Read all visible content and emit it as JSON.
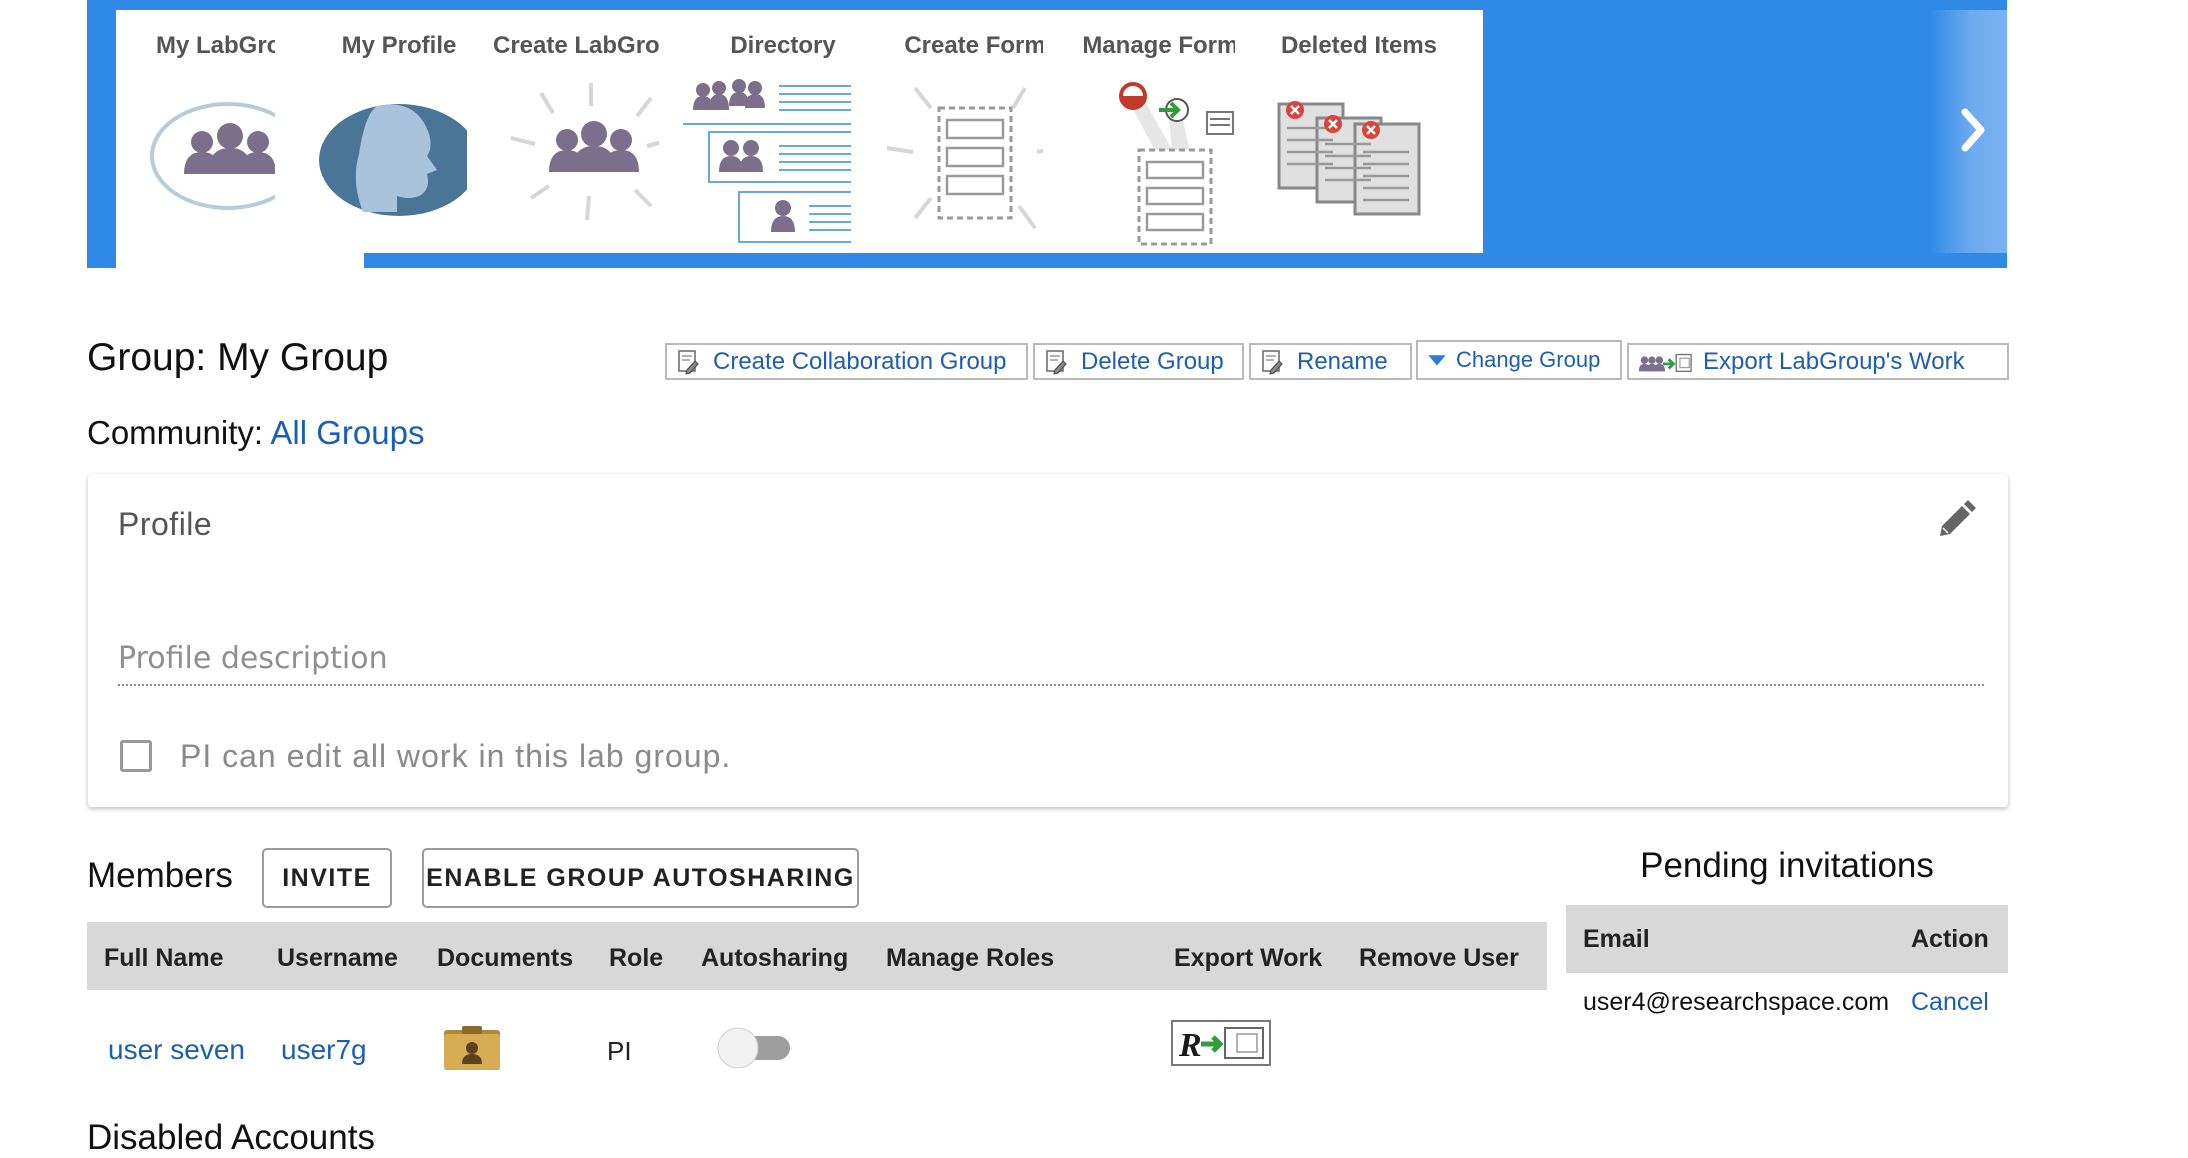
{
  "tiles": [
    {
      "label": "My LabGroups",
      "icon": "labgroups-icon",
      "active": true
    },
    {
      "label": "My Profile",
      "icon": "profile-icon",
      "active": false
    },
    {
      "label": "Create LabGroup",
      "icon": "create-labgroup-icon",
      "active": false
    },
    {
      "label": "Directory",
      "icon": "directory-icon",
      "active": false
    },
    {
      "label": "Create Form",
      "icon": "create-form-icon",
      "active": false
    },
    {
      "label": "Manage Forms",
      "icon": "manage-forms-icon",
      "active": false
    },
    {
      "label": "Deleted Items",
      "icon": "deleted-items-icon",
      "active": false
    }
  ],
  "header": {
    "group_title": "Group: My Group",
    "community_label": "Community:",
    "community_link": "All Groups"
  },
  "toolbar": {
    "create_collab": "Create Collaboration Group",
    "delete_group": "Delete Group",
    "rename": "Rename",
    "change_group": "Change Group",
    "export_work": "Export LabGroup's Work"
  },
  "profile": {
    "heading": "Profile",
    "description_placeholder": "Profile description",
    "description_value": "",
    "pi_edit_label": "PI can edit all work in this lab group.",
    "pi_edit_checked": false
  },
  "members": {
    "title": "Members",
    "invite_label": "INVITE",
    "autosharing_label": "ENABLE GROUP AUTOSHARING",
    "columns": [
      "Full Name",
      "Username",
      "Documents",
      "Role",
      "Autosharing",
      "Manage Roles",
      "Export Work",
      "Remove User"
    ],
    "rows": [
      {
        "full_name": "user seven",
        "username": "user7g",
        "role": "PI",
        "autosharing": false
      }
    ]
  },
  "pending": {
    "title": "Pending invitations",
    "columns": [
      "Email",
      "Action"
    ],
    "rows": [
      {
        "email": "user4@researchspace.com",
        "action": "Cancel"
      }
    ]
  },
  "disabled_accounts": "Disabled Accounts",
  "colors": {
    "accent_blue": "#2e8ae6",
    "link_blue": "#1a5fb4",
    "table_header_gray": "#d8d8d8"
  }
}
